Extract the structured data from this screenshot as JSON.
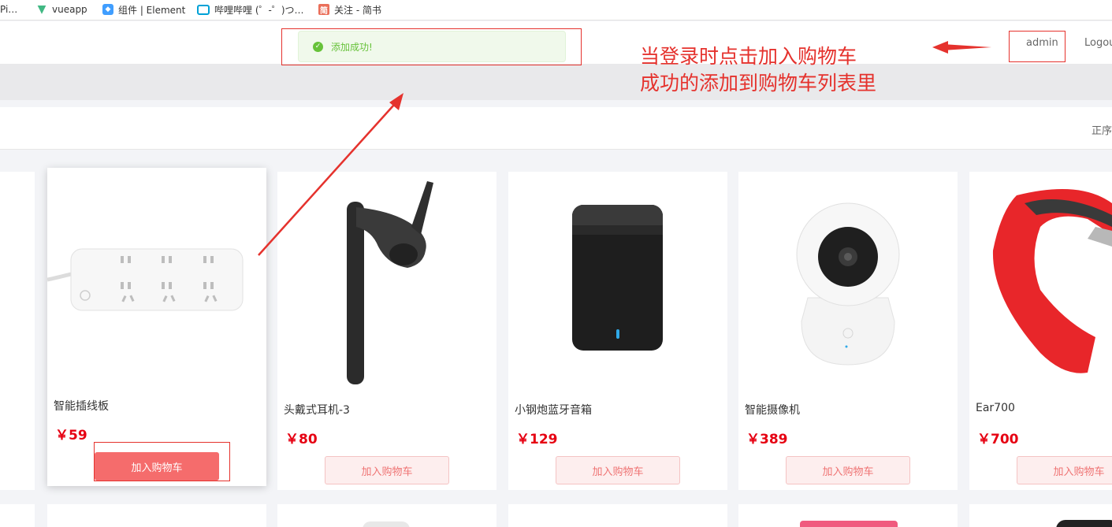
{
  "bookmarks": [
    {
      "label": "Pi…",
      "icon": "page-icon"
    },
    {
      "label": "vueapp",
      "icon": "vue-logo-icon"
    },
    {
      "label": "组件 | Element",
      "icon": "element-logo-icon"
    },
    {
      "label": "哔哩哔哩 (゜-゜)つ…",
      "icon": "bilibili-icon"
    },
    {
      "label": "关注 - 简书",
      "icon": "jianshu-icon",
      "badge": "简"
    }
  ],
  "toast": {
    "message": "添加成功!",
    "type": "success"
  },
  "header": {
    "user": "admin",
    "logout": "Logou"
  },
  "toolbar": {
    "sort_label": "正序"
  },
  "products": [
    {
      "name": "智能插线板",
      "price": "￥59",
      "button": "加入购物车",
      "active": true
    },
    {
      "name": "头戴式耳机-3",
      "price": "￥80",
      "button": "加入购物车",
      "active": false
    },
    {
      "name": "小钢炮蓝牙音箱",
      "price": "￥129",
      "button": "加入购物车",
      "active": false
    },
    {
      "name": "智能摄像机",
      "price": "￥389",
      "button": "加入购物车",
      "active": false
    },
    {
      "name": "Ear700",
      "price": "￥700",
      "button": "加入购物车",
      "active": false
    }
  ],
  "annotation": {
    "line1": "当登录时点击加入购物车",
    "line2": "成功的添加到购物车列表里",
    "color": "#e5322d"
  },
  "colors": {
    "accent": "#f56c6c",
    "price": "#e60012",
    "success": "#67c23a"
  }
}
